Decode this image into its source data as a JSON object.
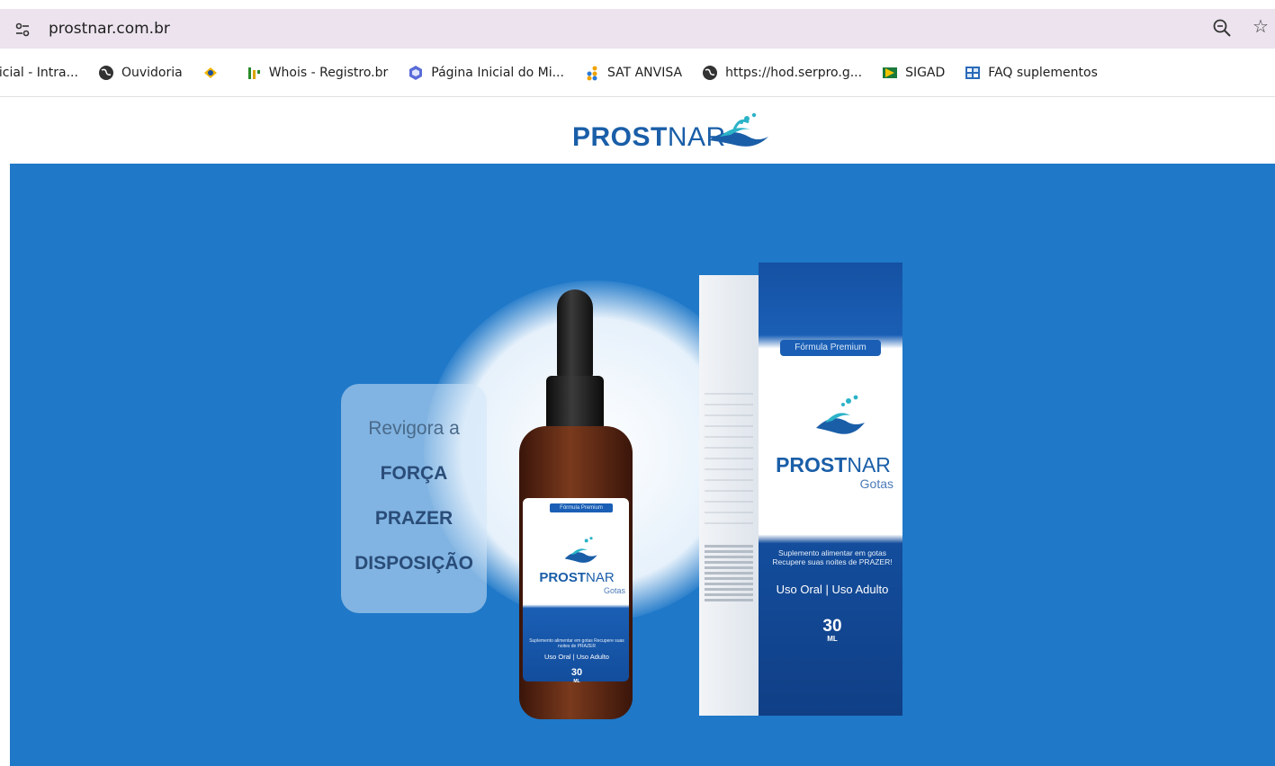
{
  "browser": {
    "url": "prostnar.com.br",
    "site_info_icon": "tune-icon",
    "zoom_icon": "zoom-out-icon",
    "bookmark_icon": "star-icon"
  },
  "bookmarks": [
    {
      "label": "nicial - Intra...",
      "icon": "page-icon"
    },
    {
      "label": "Ouvidoria",
      "icon": "globe-icon"
    },
    {
      "label": "",
      "icon": "gov-icon"
    },
    {
      "label": "Whois - Registro.br",
      "icon": "registrobr-icon"
    },
    {
      "label": "Página Inicial do Mi...",
      "icon": "colorful-hex-icon"
    },
    {
      "label": "SAT ANVISA",
      "icon": "dots-icon"
    },
    {
      "label": "https://hod.serpro.g...",
      "icon": "globe-icon"
    },
    {
      "label": "SIGAD",
      "icon": "arrow-icon"
    },
    {
      "label": "FAQ suplementos",
      "icon": "table-icon"
    }
  ],
  "site": {
    "logo_bold": "PROST",
    "logo_light": "NAR"
  },
  "hero": {
    "tagline": [
      "Revigora a",
      "FORÇA",
      "PRAZER",
      "DISPOSIÇÃO"
    ],
    "box": {
      "badge": "Fórmula Premium",
      "brand_bold": "PROST",
      "brand_light": "NAR",
      "subtitle": "Gotas",
      "description": "Suplemento alimentar em gotas Recupere suas noites de PRAZER!",
      "usage": "Uso Oral | Uso Adulto",
      "volume": "30",
      "unit": "ML"
    },
    "bottle": {
      "badge": "Fórmula Premium",
      "brand_bold": "PROST",
      "brand_light": "NAR",
      "subtitle": "Gotas",
      "description": "Suplemento alimentar em gotas Recupere suas noites de PRAZER",
      "usage": "Uso Oral | Uso Adulto",
      "volume": "30",
      "unit": "ML"
    }
  },
  "colors": {
    "hero_bg": "#1f78c8",
    "brand_blue": "#1a5ea8",
    "accent_teal": "#2bb3c8",
    "address_bar": "#ece3ee"
  }
}
